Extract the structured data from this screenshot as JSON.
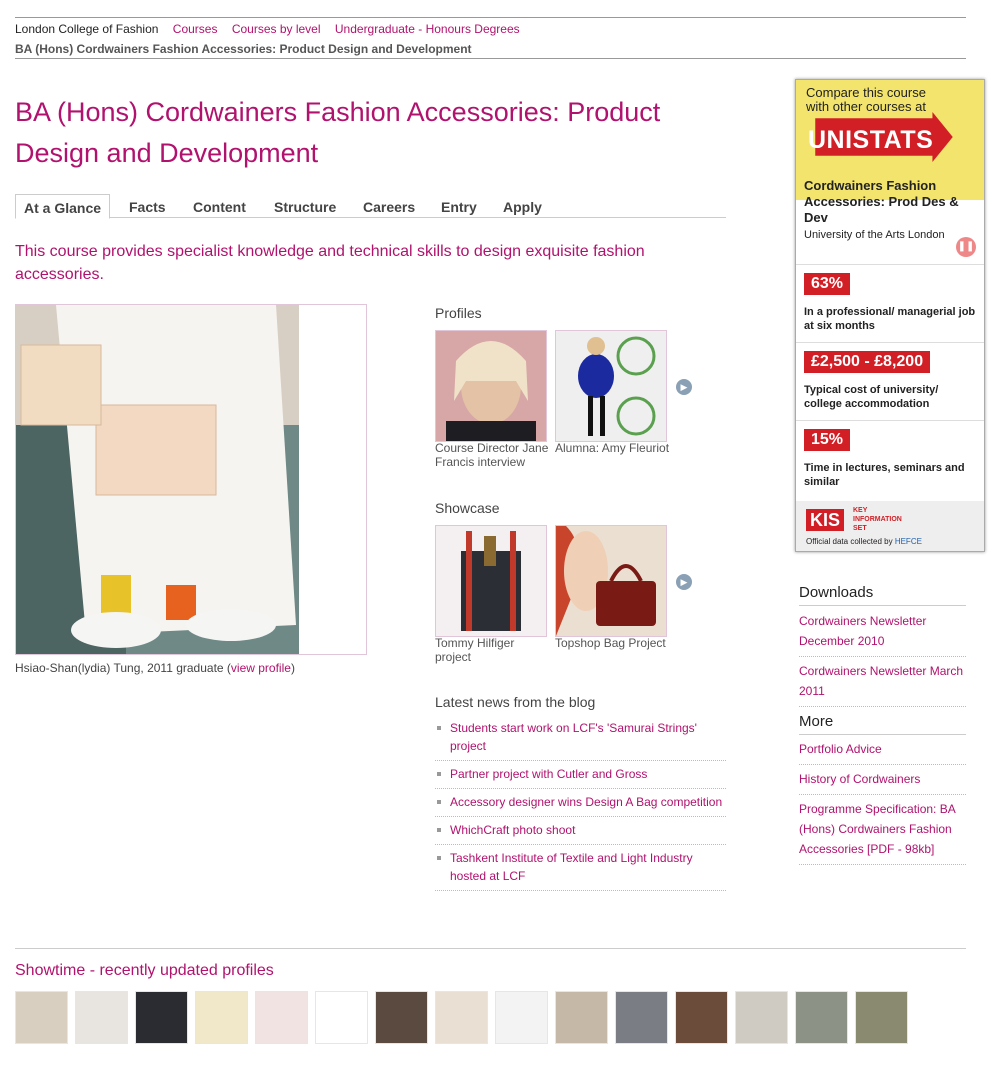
{
  "breadcrumb": {
    "items": [
      "London College of Fashion",
      "Courses",
      "Courses by level",
      "Undergraduate - Honours Degrees"
    ],
    "current": "BA (Hons) Cordwainers Fashion Accessories: Product Design and Development"
  },
  "page_title": "BA (Hons) Cordwainers Fashion Accessories: Product Design and Development",
  "tabs": [
    "At a Glance",
    "Facts",
    "Content",
    "Structure",
    "Careers",
    "Entry",
    "Apply"
  ],
  "intro": "This course provides specialist knowledge and technical skills to design exquisite fashion accessories.",
  "photo_caption": {
    "text": "Hsiao-Shan(lydia) Tung, 2011 graduate (",
    "link": "view profile",
    "end": ")"
  },
  "profiles": {
    "heading": "Profiles",
    "items": [
      {
        "caption": "Course Director Jane Francis interview"
      },
      {
        "caption": "Alumna: Amy Fleuriot"
      }
    ]
  },
  "showcase": {
    "heading": "Showcase",
    "items": [
      {
        "caption": "Tommy Hilfiger project"
      },
      {
        "caption": "Topshop Bag Project"
      }
    ]
  },
  "blog": {
    "heading": "Latest news from the blog",
    "items": [
      "Students start work on LCF's 'Samurai Strings' project",
      "Partner project with Cutler and Gross",
      "Accessory designer wins Design A Bag competition",
      "WhichCraft photo shoot",
      "Tashkent Institute of Textile and Light Industry hosted at LCF"
    ]
  },
  "unistats": {
    "compare_text": "Compare this course with other courses at",
    "banner": "UNISTATS",
    "course": "Cordwainers Fashion Accessories: Prod Des & Dev",
    "university": "University of the Arts London",
    "stats": [
      {
        "value": "63%",
        "label": "In a professional/ managerial job at six months"
      },
      {
        "value": "£2,500 - £8,200",
        "label": "Typical cost of university/ college accommodation"
      },
      {
        "value": "15%",
        "label": "Time in lectures, seminars and similar"
      }
    ],
    "kis_logo": "KIS",
    "kis_sub": "KEY INFORMATION SET",
    "official": "Official data collected by",
    "official_org": "HEFCE"
  },
  "downloads": {
    "heading": "Downloads",
    "items": [
      "Cordwainers Newsletter December 2010",
      "Cordwainers Newsletter March 2011"
    ]
  },
  "more": {
    "heading": "More",
    "items": [
      "Portfolio Advice",
      "History of Cordwainers",
      "Programme Specification: BA (Hons) Cordwainers Fashion Accessories [PDF - 98kb]"
    ]
  },
  "showtime": {
    "heading": "Showtime - recently updated profiles",
    "thumb_colors": [
      "#d8cfc0",
      "#e8e4e0",
      "#2a2c32",
      "#f1e7c9",
      "#f0e3e2",
      "#ffffff",
      "#5a4a40",
      "#e9dfd3",
      "#f3f3f3",
      "#c5b8a6",
      "#7b7d84",
      "#6b4b3a",
      "#cfcbc2",
      "#8d9287",
      "#8a8a70"
    ]
  },
  "colors": {
    "accent": "#b0126e",
    "unistats_red": "#d21f26",
    "unistats_yellow": "#f2e46d"
  }
}
